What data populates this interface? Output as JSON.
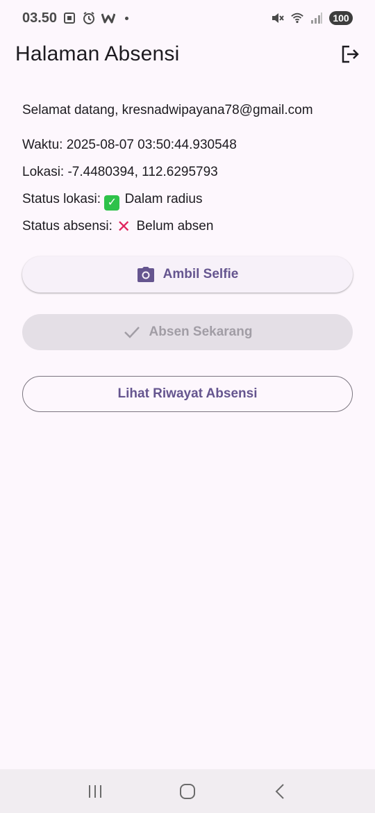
{
  "status_bar": {
    "time": "03.50",
    "battery": "100",
    "icons": [
      "screenshot-icon",
      "alarm-icon",
      "w-app-icon",
      "notification-dot",
      "mute-icon",
      "wifi-icon",
      "signal-icon"
    ]
  },
  "app_bar": {
    "title": "Halaman Absensi",
    "logout_icon": "logout-icon"
  },
  "info": {
    "welcome": "Selamat datang, kresnadwipayana78@gmail.com",
    "time": "Waktu: 2025-08-07 03:50:44.930548",
    "location": "Lokasi: -7.4480394, 112.6295793",
    "location_status_prefix": "Status lokasi:",
    "location_status_emoji": "✅",
    "location_status_value": "Dalam radius",
    "attendance_status_prefix": "Status absensi:",
    "attendance_status_emoji": "❌",
    "attendance_status_value": "Belum absen"
  },
  "buttons": {
    "selfie": {
      "label": "Ambil Selfie",
      "icon": "camera-icon"
    },
    "absen": {
      "label": "Absen Sekarang",
      "icon": "check-icon",
      "enabled": false
    },
    "history": {
      "label": "Lihat Riwayat Absensi"
    }
  },
  "nav_bar": {
    "icons": [
      "recent-apps-icon",
      "home-icon",
      "back-icon"
    ]
  },
  "colors": {
    "background": "#fdf7fd",
    "primary": "#65558f",
    "disabled_bg": "#e4dfe6",
    "disabled_text": "#a19da5"
  }
}
